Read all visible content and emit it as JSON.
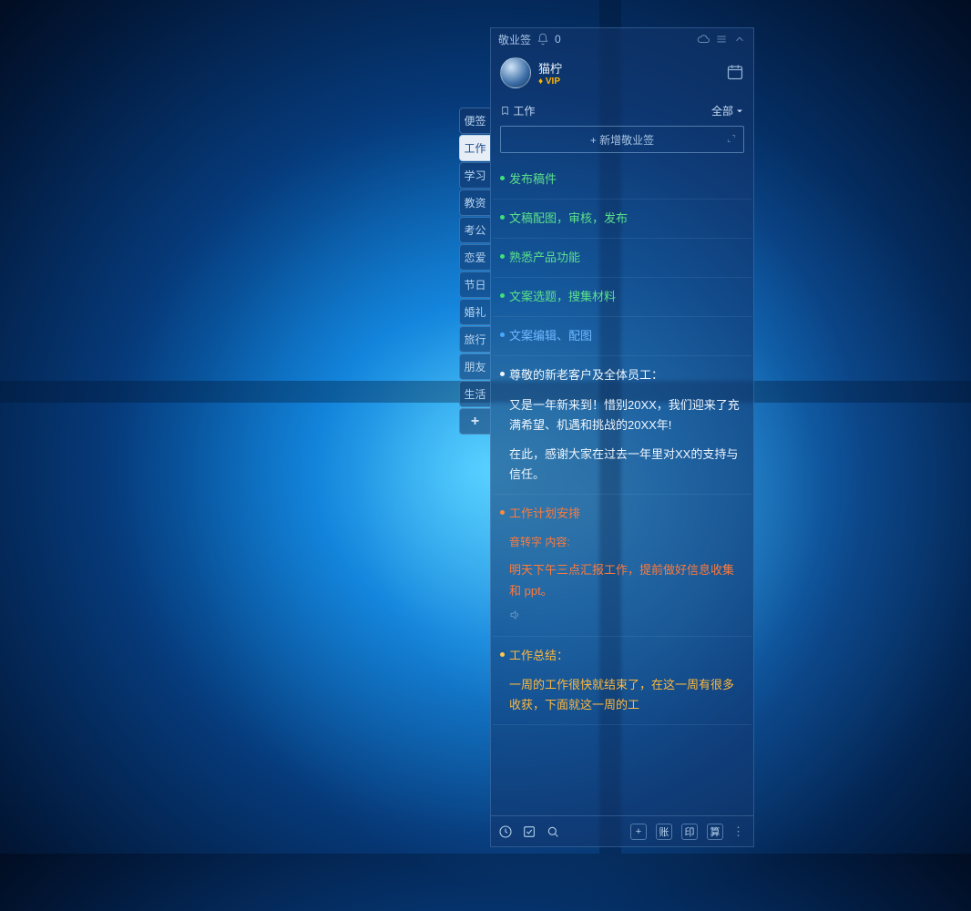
{
  "app": {
    "title": "敬业签",
    "notif_count": "0"
  },
  "profile": {
    "username": "猫柠",
    "vip_label": "VIP"
  },
  "category": {
    "name": "工作",
    "filter_label": "全部"
  },
  "add_button": {
    "label": "+ 新增敬业签"
  },
  "sidebar": {
    "tabs": [
      {
        "label": "便签"
      },
      {
        "label": "工作"
      },
      {
        "label": "学习"
      },
      {
        "label": "教资"
      },
      {
        "label": "考公"
      },
      {
        "label": "恋爱"
      },
      {
        "label": "节日"
      },
      {
        "label": "婚礼"
      },
      {
        "label": "旅行"
      },
      {
        "label": "朋友"
      },
      {
        "label": "生活"
      }
    ],
    "add_label": "+"
  },
  "notes": [
    {
      "color": "green",
      "lines": [
        "发布稿件"
      ]
    },
    {
      "color": "green",
      "lines": [
        "文稿配图，审核，发布"
      ]
    },
    {
      "color": "green",
      "lines": [
        "熟悉产品功能"
      ]
    },
    {
      "color": "green",
      "lines": [
        "文案选题，搜集材料"
      ]
    },
    {
      "color": "blue",
      "lines": [
        "文案编辑、配图"
      ]
    },
    {
      "color": "white",
      "lines": [
        "尊敬的新老客户及全体员工：",
        "又是一年新来到！惜别20XX，我们迎来了充满希望、机遇和挑战的20XX年!",
        "在此，感谢大家在过去一年里对XX的支持与信任。"
      ]
    },
    {
      "color": "orange",
      "lines": [
        "工作计划安排",
        "音转字 内容:",
        "明天下午三点汇报工作，提前做好信息收集和 ppt。"
      ],
      "has_audio": true
    },
    {
      "color": "yellow",
      "lines": [
        "工作总结：",
        "一周的工作很快就结束了，在这一周有很多收获，下面就这一周的工"
      ]
    }
  ],
  "bottom": {
    "btn_add": "+",
    "btn_account": "账",
    "btn_print": "印",
    "btn_calc": "算"
  }
}
